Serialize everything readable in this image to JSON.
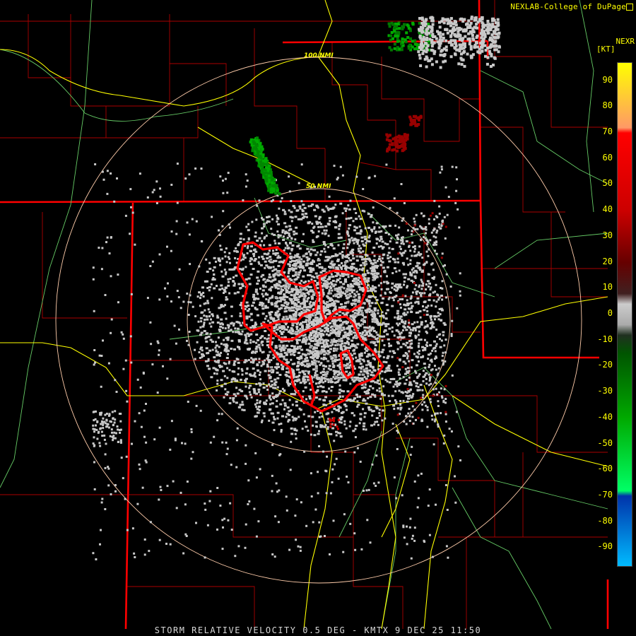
{
  "header": {
    "credit": "NEXLAB-College of DuPage",
    "product": "NEXR",
    "units": "[KT]"
  },
  "footer": {
    "caption": "STORM RELATIVE VELOCITY 0.5 DEG - KMTX 9 DEC 25 11:50"
  },
  "range_rings": [
    {
      "label": "50 NMI"
    },
    {
      "label": "100 NMI"
    }
  ],
  "legend": {
    "ticks": [
      "90",
      "80",
      "70",
      "60",
      "50",
      "40",
      "30",
      "20",
      "10",
      "0",
      "-10",
      "-20",
      "-30",
      "-40",
      "-50",
      "-60",
      "-70",
      "-80",
      "-90"
    ],
    "max": 97,
    "min": -97,
    "stops": [
      {
        "value": 97,
        "color": "#ffff00"
      },
      {
        "value": 72,
        "color": "#ff9966"
      },
      {
        "value": 70,
        "color": "#ff0000"
      },
      {
        "value": 40,
        "color": "#cc0000"
      },
      {
        "value": 20,
        "color": "#660000"
      },
      {
        "value": 8,
        "color": "#402020"
      },
      {
        "value": 4,
        "color": "#cccccc"
      },
      {
        "value": -4,
        "color": "#aaaaaa"
      },
      {
        "value": -8,
        "color": "#203020"
      },
      {
        "value": -15,
        "color": "#005500"
      },
      {
        "value": -40,
        "color": "#00aa00"
      },
      {
        "value": -68,
        "color": "#00ff66"
      },
      {
        "value": -70,
        "color": "#0033aa"
      },
      {
        "value": -97,
        "color": "#00bbff"
      }
    ]
  },
  "colors": {
    "state_border": "#ff0000",
    "county_border": "#aa0000",
    "highway": "#ffff00",
    "river": "#66cc66",
    "range_ring": "#ffccaa",
    "warning_polygon": "#ff0000",
    "inbound": "#00aa00",
    "outbound": "#990000",
    "near_zero": "#c8c8c8"
  },
  "echo_seed": 20251209
}
